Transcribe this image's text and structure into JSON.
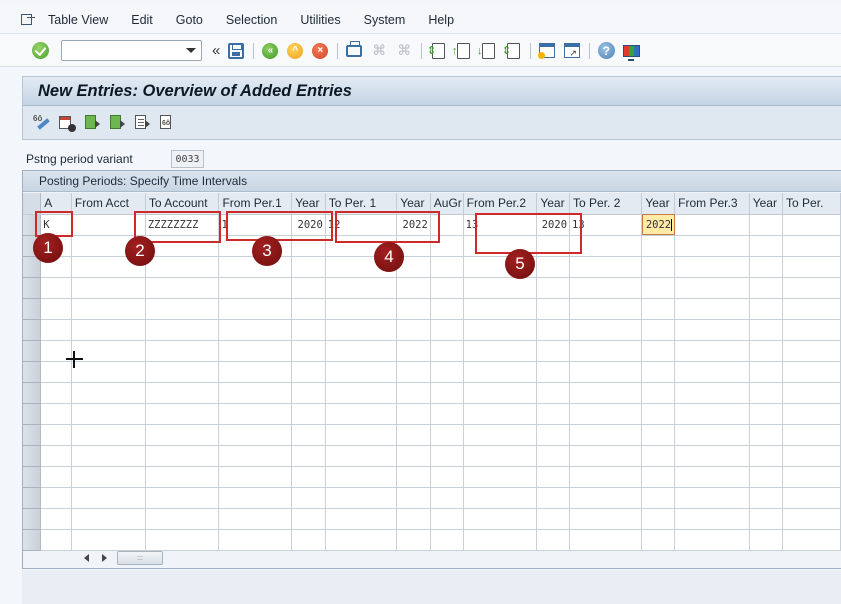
{
  "menubar": {
    "items": [
      "Table View",
      "Edit",
      "Goto",
      "Selection",
      "Utilities",
      "System",
      "Help"
    ]
  },
  "toolbar": {
    "command_field_value": "",
    "icons": [
      "enter-icon",
      "save-icon",
      "back-icon",
      "exit-icon",
      "cancel-icon",
      "print-icon",
      "find-icon",
      "find-next-icon",
      "first-page-icon",
      "previous-page-icon",
      "next-page-icon",
      "last-page-icon",
      "create-session-icon",
      "shortcut-icon",
      "help-icon",
      "customize-layout-icon"
    ]
  },
  "screen": {
    "title": "New Entries: Overview of Added Entries"
  },
  "variant": {
    "label": "Pstng period variant",
    "value": "0033"
  },
  "table": {
    "title": "Posting Periods: Specify Time Intervals",
    "columns": [
      "A",
      "From Acct",
      "To Account",
      "From Per.1",
      "Year",
      "To Per. 1",
      "Year",
      "AuGr",
      "From Per.2",
      "Year",
      "To Per. 2",
      "Year",
      "From Per.3",
      "Year",
      "To Per."
    ],
    "rows": [
      [
        "K",
        "",
        "ZZZZZZZZ",
        "1",
        "2020",
        "12",
        "2022",
        "",
        "13",
        "2020",
        "13",
        "2022",
        "",
        "",
        ""
      ]
    ],
    "empty_row_count": 15,
    "focused_cell": {
      "row": 0,
      "column": 11
    }
  },
  "annotations": [
    "1",
    "2",
    "3",
    "4",
    "5"
  ]
}
